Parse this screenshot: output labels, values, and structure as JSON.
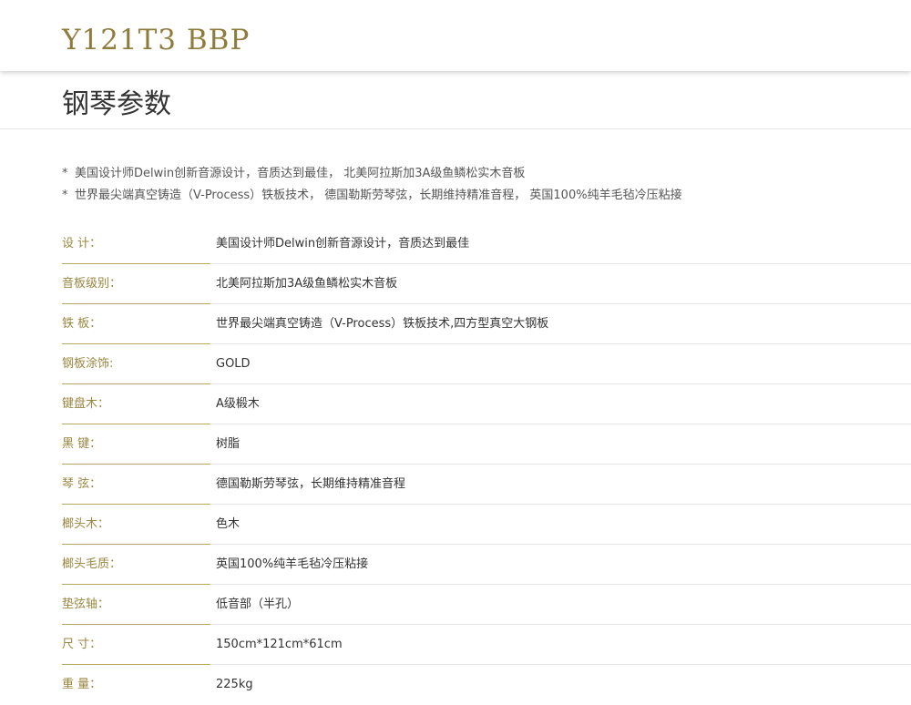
{
  "header": {
    "model": "Y121T3 BBP"
  },
  "section": {
    "title": "钢琴参数"
  },
  "notes": [
    {
      "star": "*",
      "text": "美国设计师Delwin创新音源设计，音质达到最佳， 北美阿拉斯加3A级鱼鳞松实木音板"
    },
    {
      "star": "*",
      "text": "世界最尖端真空铸造（V-Process）铁板技术， 德国勒斯劳琴弦，长期维持精准音程， 英国100%纯羊毛毡冷压粘接"
    }
  ],
  "specs": [
    {
      "label": "设 计：",
      "value": "美国设计师Delwin创新音源设计，音质达到最佳"
    },
    {
      "label": "音板级别：",
      "value": "北美阿拉斯加3A级鱼鳞松实木音板"
    },
    {
      "label": "铁 板：",
      "value": "世界最尖端真空铸造（V-Process）铁板技术,四方型真空大钢板"
    },
    {
      "label": "钢板涂饰:",
      "value": "GOLD"
    },
    {
      "label": "键盘木：",
      "value": "A级椴木"
    },
    {
      "label": "黑 键：",
      "value": "树脂"
    },
    {
      "label": "琴 弦：",
      "value": "德国勒斯劳琴弦，长期维持精准音程"
    },
    {
      "label": "榔头木：",
      "value": "色木"
    },
    {
      "label": "榔头毛质：",
      "value": "英国100%纯羊毛毡冷压粘接"
    },
    {
      "label": "垫弦轴：",
      "value": "低音部（半孔）"
    },
    {
      "label": "尺 寸：",
      "value": "150cm*121cm*61cm"
    },
    {
      "label": "重 量：",
      "value": "225kg"
    }
  ],
  "colors": {
    "accent": "#9a8640",
    "title": "#8f7c3c",
    "text": "#333333",
    "note_text": "#555555",
    "divider": "#e6e6e6"
  }
}
